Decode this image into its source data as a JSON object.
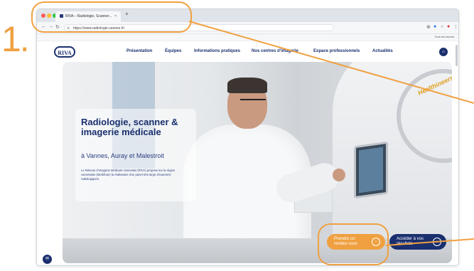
{
  "annotation": {
    "step": "1."
  },
  "browser": {
    "tab_title": "RIVA – Radiologie, Scanner...",
    "tab_close": "×",
    "new_tab": "+",
    "url": "https://www.radiologie-vannes.fr/",
    "bookmarks_label": "Tous les favoris"
  },
  "site": {
    "logo": "RIVA",
    "nav": [
      "Présentation",
      "Équipes",
      "Informations pratiques",
      "Nos centres d'imagerie",
      "Espace professionnels",
      "Actualités"
    ],
    "hero": {
      "headline": "Radiologie, scanner & imagerie médicale",
      "subline": "à Vannes, Auray et Malestroit",
      "description": "Le Réseau d'Imagerie Médicale Vannetais (RIVA) propose sur la région vannetaise (Morbihan) la réalisation d'un panel très large d'examens radiologiques.",
      "scanner_brand": "Healthineers"
    },
    "buttons": {
      "appointment": "Prendre un rendez-vous",
      "results": "Accéder à vos résultats"
    }
  },
  "colors": {
    "accent": "#f0a040",
    "brand": "#1a2f6e"
  }
}
